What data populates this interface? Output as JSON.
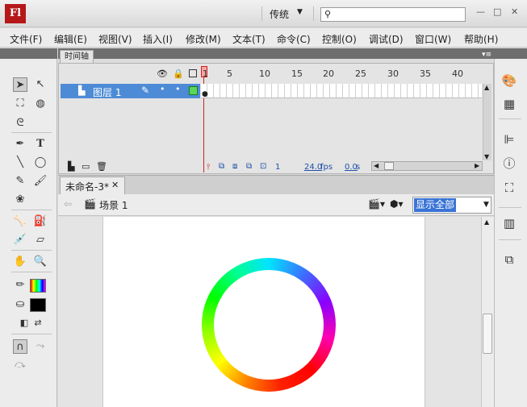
{
  "app": {
    "logo": "Fl",
    "workspace": "传统",
    "search_placeholder": "",
    "window_buttons": [
      "—",
      "□",
      "✕"
    ]
  },
  "menu": [
    "文件(F)",
    "编辑(E)",
    "视图(V)",
    "插入(I)",
    "修改(M)",
    "文本(T)",
    "命令(C)",
    "控制(O)",
    "调试(D)",
    "窗口(W)",
    "帮助(H)"
  ],
  "timeline": {
    "tab_label": "时间轴",
    "layer_name": "图层 1",
    "frame_ticks": [
      "1",
      "5",
      "10",
      "15",
      "20",
      "25",
      "30",
      "35",
      "40"
    ],
    "status": {
      "frame": "1",
      "fps": "24.0",
      "fps_unit": "fps",
      "time": "0.0",
      "time_unit": "s"
    }
  },
  "document": {
    "tab_label": "未命名-3*",
    "tab_close": "✕",
    "scene": "场景 1",
    "zoom": "显示全部"
  },
  "icons": {
    "tools": [
      "selection-tool-icon",
      "subselection-tool-icon",
      "free-transform-icon",
      "3d-rotation-icon",
      "lasso-icon",
      "pen-icon",
      "text-icon",
      "line-icon",
      "oval-icon",
      "pencil-icon",
      "brush-icon",
      "deco-icon",
      "bone-icon",
      "paint-bucket-icon",
      "eyedropper-icon",
      "eraser-icon",
      "hand-icon",
      "zoom-icon"
    ],
    "right_panel": [
      "color-icon",
      "swatches-icon",
      "align-icon",
      "info-icon",
      "transform-icon",
      "library-icon",
      "components-icon"
    ]
  },
  "colors": {
    "accent": "#4d8bd6",
    "playhead": "#d02020",
    "logo_bg": "#b51818",
    "fill_color": "#000000"
  }
}
